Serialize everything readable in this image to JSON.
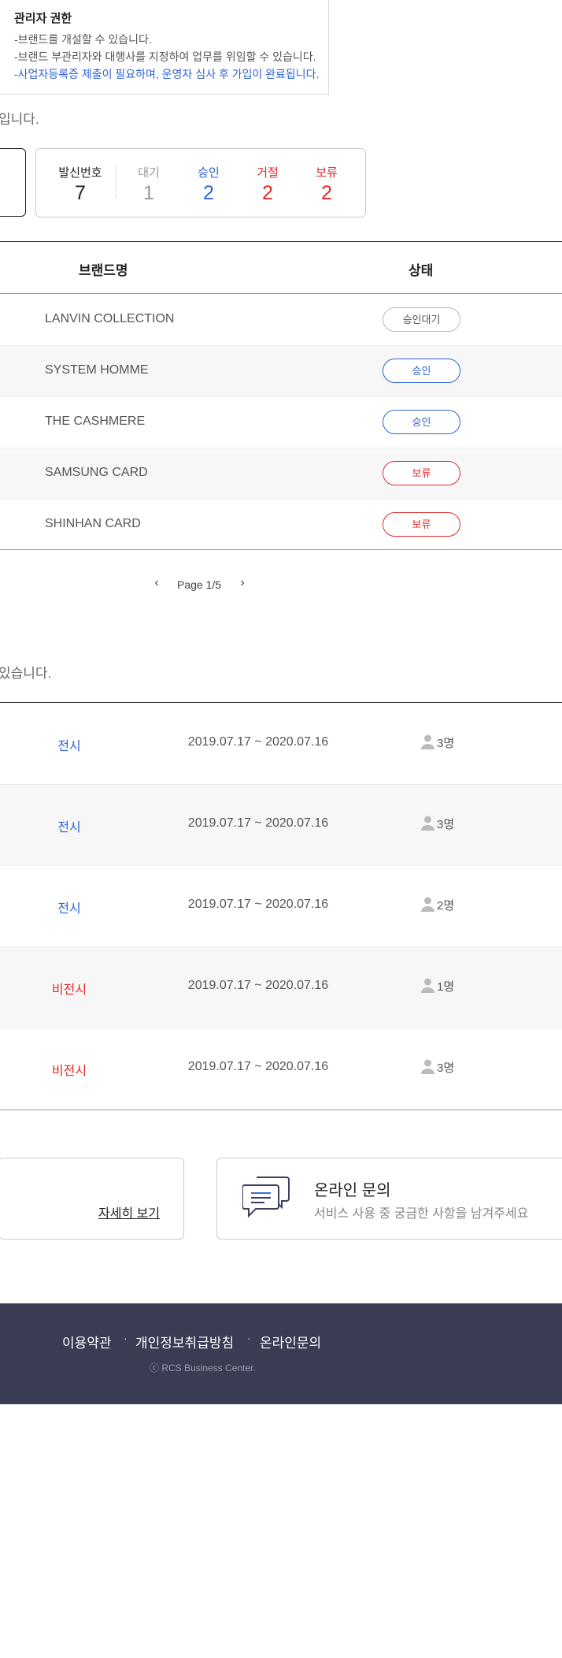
{
  "admin": {
    "title": "관리자 권한",
    "lines": [
      "-브랜드를 개설할 수 있습니다.",
      "-브랜드 부관리자와 대행사를 지정하여 업무를 위임할 수 있습니다.",
      "-사업자등록증 제출이 필요하며, 운영자 심사 후 가입이 완료됩니다."
    ]
  },
  "section1_desc": "입니다.",
  "sender_stats": {
    "label": "발신번호",
    "total": "7",
    "items": [
      {
        "label": "대기",
        "value": "1",
        "color": "#999999"
      },
      {
        "label": "승인",
        "value": "2",
        "color": "#2f63d6"
      },
      {
        "label": "거절",
        "value": "2",
        "color": "#e02a2a"
      },
      {
        "label": "보류",
        "value": "2",
        "color": "#e02a2a"
      }
    ]
  },
  "brand_table": {
    "headers": {
      "name": "브랜드명",
      "status": "상태"
    },
    "rows": [
      {
        "name": "LANVIN COLLECTION",
        "status": "승인대기",
        "kind": "wait"
      },
      {
        "name": "SYSTEM HOMME",
        "status": "승인",
        "kind": "approve"
      },
      {
        "name": "THE CASHMERE",
        "status": "승인",
        "kind": "approve"
      },
      {
        "name": "SAMSUNG CARD",
        "status": "보류",
        "kind": "hold"
      },
      {
        "name": "SHINHAN CARD",
        "status": "보류",
        "kind": "hold"
      }
    ]
  },
  "pagination": {
    "label": "Page 1/5",
    "prev": "‹",
    "next": "›"
  },
  "section2_desc": "있습니다.",
  "display_table": {
    "rows": [
      {
        "display": "전시",
        "on": true,
        "period": "2019.07.17 ~ 2020.07.16",
        "people": "3명"
      },
      {
        "display": "전시",
        "on": true,
        "period": "2019.07.17 ~ 2020.07.16",
        "people": "3명"
      },
      {
        "display": "전시",
        "on": true,
        "period": "2019.07.17 ~ 2020.07.16",
        "people": "2명"
      },
      {
        "display": "비전시",
        "on": false,
        "period": "2019.07.17 ~ 2020.07.16",
        "people": "1명"
      },
      {
        "display": "비전시",
        "on": false,
        "period": "2019.07.17 ~ 2020.07.16",
        "people": "3명"
      }
    ]
  },
  "cards": {
    "detail_link": "자세히 보기",
    "inquiry_title": "온라인 문의",
    "inquiry_desc": "서비스 사용 중 궁금한 사항을 남겨주세요",
    "inquiry_icon": "chat-bubbles-icon"
  },
  "footer": {
    "links": [
      "이용약관",
      "개인정보취급방침",
      "온라인문의"
    ],
    "copyright": "ⓒ RCS Business Center."
  },
  "colors": {
    "accent_blue": "#2f63d6",
    "alert_red": "#e02a2a",
    "footer_bg": "#393c53"
  }
}
